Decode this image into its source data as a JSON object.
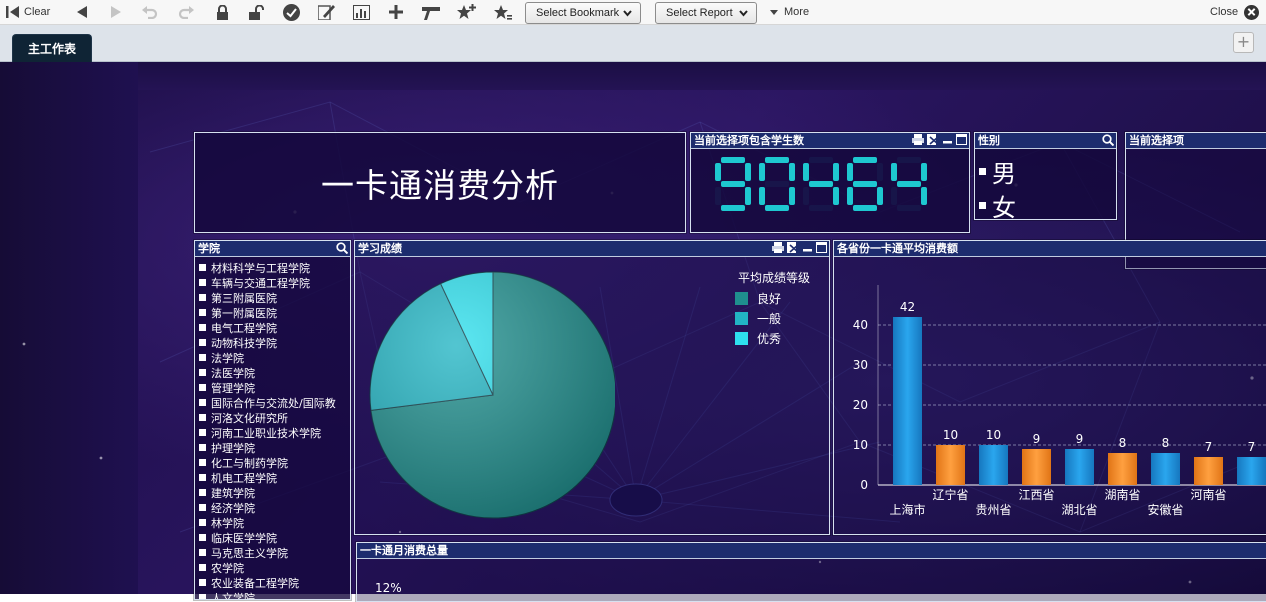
{
  "toolbar": {
    "clear_label": "Clear",
    "bookmark_label": "Select Bookmark",
    "report_label": "Select Report",
    "more_label": "More",
    "close_label": "Close"
  },
  "tabs": [
    {
      "label": "主工作表",
      "active": true
    }
  ],
  "dashboard": {
    "title": "一卡通消费分析",
    "student_count": {
      "caption": "当前选择项包含学生数",
      "value": "90464",
      "digit_color": "#1ec8d0"
    },
    "gender": {
      "caption": "性别",
      "options": [
        "男",
        "女"
      ]
    },
    "current_selection": {
      "caption": "当前选择项"
    },
    "college": {
      "caption": "学院",
      "items": [
        "材料科学与工程学院",
        "车辆与交通工程学院",
        "第三附属医院",
        "第一附属医院",
        "电气工程学院",
        "动物科技学院",
        "法学院",
        "法医学院",
        "管理学院",
        "国际合作与交流处/国际教",
        "河洛文化研究所",
        "河南工业职业技术学院",
        "护理学院",
        "化工与制药学院",
        "机电工程学院",
        "建筑学院",
        "经济学院",
        "林学院",
        "临床医学学院",
        "马克思主义学院",
        "农学院",
        "农业装备工程学院",
        "人文学院"
      ]
    },
    "monthly": {
      "caption": "一卡通月消费总量",
      "tick_visible": "12%"
    }
  },
  "chart_data": [
    {
      "type": "pie",
      "caption": "学习成绩",
      "legend_title": "平均成绩等级",
      "legend_position": "top-right",
      "categories": [
        "良好",
        "一般",
        "优秀"
      ],
      "values": [
        73,
        20,
        7
      ],
      "colors": [
        "#1f8f8e",
        "#22b5c4",
        "#2ee0ee"
      ]
    },
    {
      "type": "bar",
      "caption": "各省份一卡通平均消费额",
      "categories": [
        "上海市",
        "辽宁省",
        "贵州省",
        "江西省",
        "湖北省",
        "湖南省",
        "安徽省",
        "河南省",
        ""
      ],
      "values": [
        42,
        10,
        10,
        9,
        9,
        8,
        8,
        7,
        7
      ],
      "data_labels": [
        "42",
        "10",
        "10",
        "9",
        "9",
        "8",
        "8",
        "7",
        "7"
      ],
      "colors": [
        "#1b8ed8",
        "#f08a24",
        "#1b8ed8",
        "#f08a24",
        "#1b8ed8",
        "#f08a24",
        "#1b8ed8",
        "#f08a24",
        "#1b8ed8"
      ],
      "yticks": [
        "0",
        "10",
        "20",
        "30",
        "40"
      ],
      "ylim": [
        0,
        50
      ],
      "grid": true
    }
  ]
}
